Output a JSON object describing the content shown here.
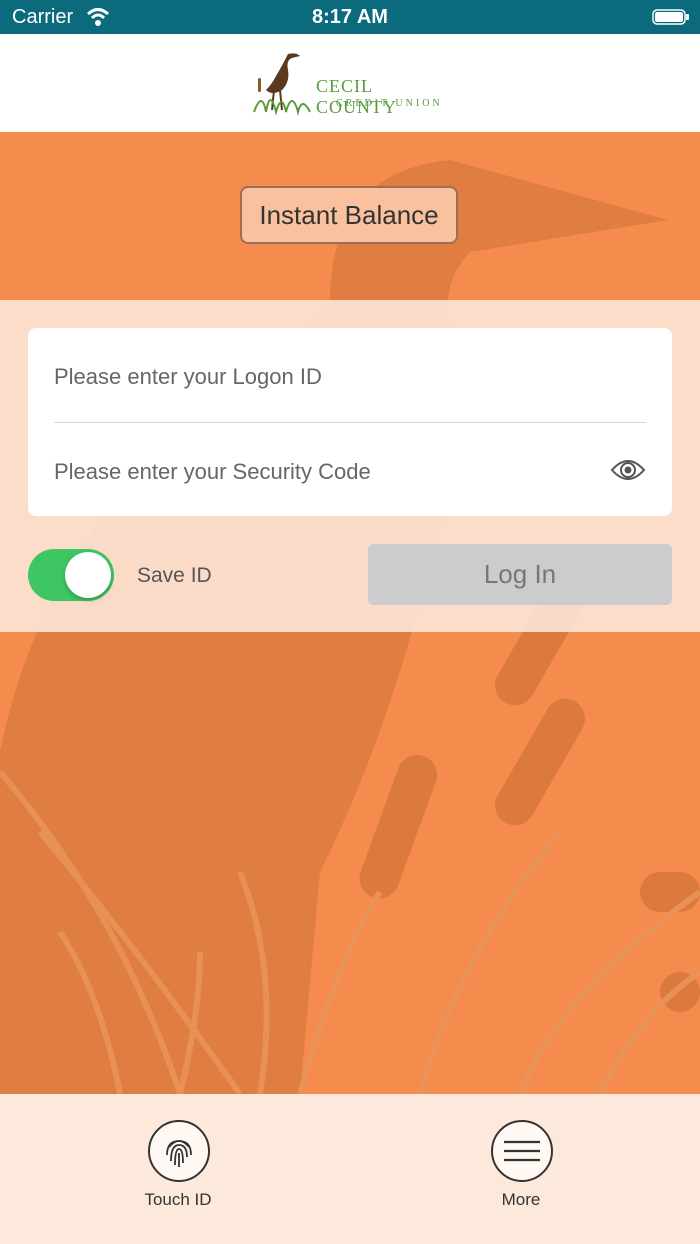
{
  "status_bar": {
    "carrier": "Carrier",
    "time": "8:17 AM"
  },
  "logo": {
    "line1": "CECIL COUNTY",
    "line2": "CREDIT UNION"
  },
  "instant_balance_label": "Instant Balance",
  "login": {
    "logon_placeholder": "Please enter your Logon ID",
    "security_placeholder": "Please enter your Security Code",
    "save_id_label": "Save ID",
    "save_id_on": true,
    "login_button": "Log In"
  },
  "bottom_nav": {
    "touch_id": "Touch ID",
    "more": "More"
  },
  "colors": {
    "status_bar": "#0b6a7c",
    "orange": "#f58c4d",
    "toggle_on": "#3dc661",
    "logo_green": "#5a9a3c"
  },
  "icons": [
    "wifi-icon",
    "battery-icon",
    "heron-logo-icon",
    "eye-icon",
    "fingerprint-icon",
    "menu-icon"
  ]
}
